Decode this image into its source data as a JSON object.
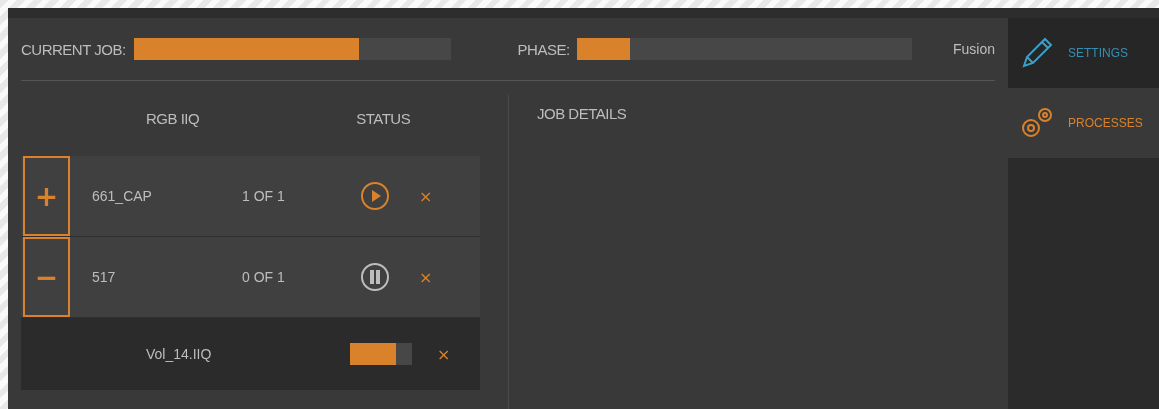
{
  "header": {
    "current_job": {
      "label": "CURRENT JOB:",
      "level": 0.71
    },
    "phase": {
      "label": "PHASE:",
      "level": 0.16,
      "value": "Fusion"
    }
  },
  "queue": {
    "columns": [
      "RGB IIQ",
      "STATUS"
    ],
    "rows": [
      {
        "kind": "running",
        "toggle": "+",
        "name": "661_CAP",
        "count": "1 OF 1",
        "remove": "×"
      },
      {
        "kind": "paused",
        "toggle": "−",
        "name": "517",
        "count": "0 OF 1",
        "remove": "×",
        "children": [
          {
            "name": "Vol_14.IIQ",
            "level": 0.74,
            "remove": "×"
          }
        ]
      }
    ]
  },
  "details": {
    "title": "JOB DETAILS"
  },
  "sidebar": {
    "items": [
      {
        "kind": "pencil",
        "label": "SETTINGS",
        "selected": false
      },
      {
        "kind": "gears",
        "label": "PROCESSES",
        "selected": true
      }
    ]
  }
}
